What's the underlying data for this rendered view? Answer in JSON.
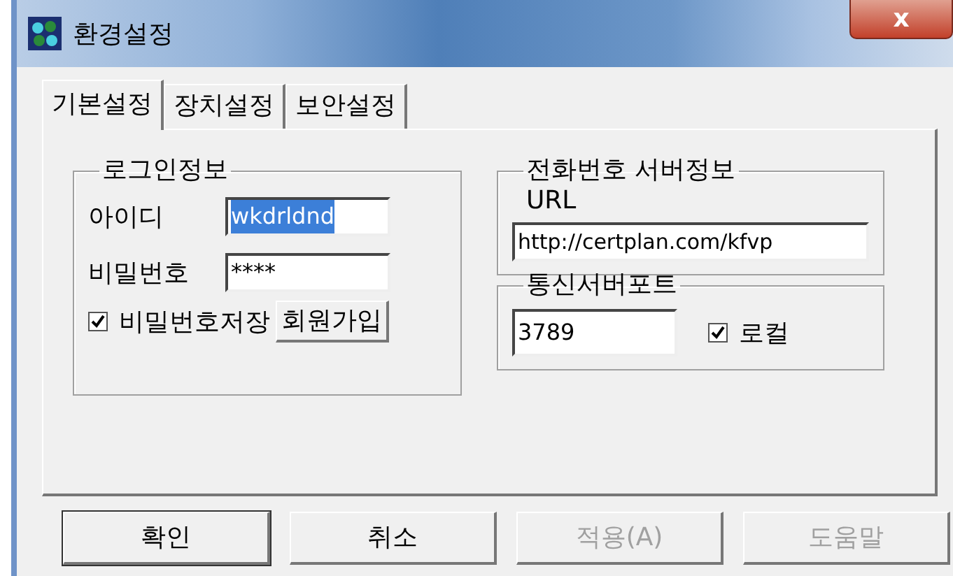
{
  "window": {
    "title": "환경설정",
    "close_label": "x"
  },
  "tabs": [
    {
      "label": "기본설정",
      "selected": true
    },
    {
      "label": "장치설정",
      "selected": false
    },
    {
      "label": "보안설정",
      "selected": false
    }
  ],
  "login_group": {
    "title": "로그인정보",
    "id_label": "아이디",
    "id_value": "wkdrldnd",
    "id_value_highlighted": true,
    "password_label": "비밀번호",
    "password_value": "****",
    "save_password": {
      "label": "비밀번호저장",
      "checked": true
    },
    "signup_button": "회원가입"
  },
  "phone_server_group": {
    "title": "전화번호 서버정보",
    "url_label": "URL",
    "url_value": "http://certplan.com/kfvp"
  },
  "port_group": {
    "title": "통신서버포트",
    "port_value": "3789",
    "local": {
      "label": "로컬",
      "checked": true
    }
  },
  "buttons": [
    {
      "label": "확인",
      "default": true,
      "disabled": false
    },
    {
      "label": "취소",
      "default": false,
      "disabled": false
    },
    {
      "label": "적용(A)",
      "default": false,
      "disabled": true
    },
    {
      "label": "도움말",
      "default": false,
      "disabled": true
    }
  ]
}
